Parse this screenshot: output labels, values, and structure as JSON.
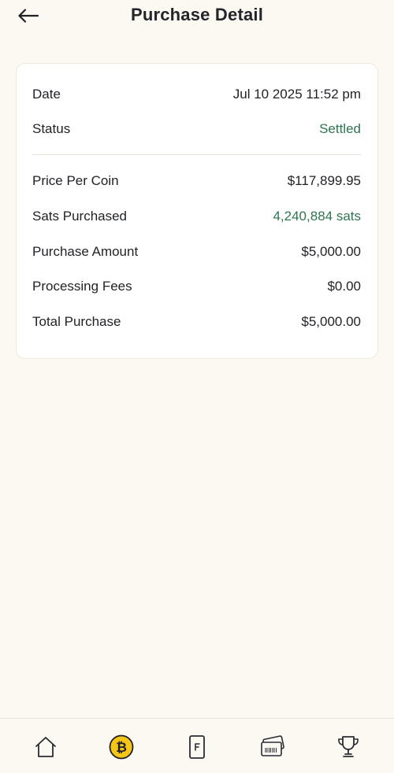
{
  "header": {
    "title": "Purchase Detail",
    "back_icon": "arrow-left-icon"
  },
  "details": {
    "date_label": "Date",
    "date_value": "Jul 10 2025 11:52 pm",
    "status_label": "Status",
    "status_value": "Settled",
    "price_label": "Price Per Coin",
    "price_value": "$117,899.95",
    "sats_label": "Sats Purchased",
    "sats_value": "4,240,884 sats",
    "amount_label": "Purchase Amount",
    "amount_value": "$5,000.00",
    "fees_label": "Processing Fees",
    "fees_value": "$0.00",
    "total_label": "Total Purchase",
    "total_value": "$5,000.00"
  },
  "nav": {
    "items": [
      {
        "icon": "home-icon",
        "active": false
      },
      {
        "icon": "bitcoin-icon",
        "active": true
      },
      {
        "icon": "fold-card-icon",
        "active": false
      },
      {
        "icon": "gift-cards-icon",
        "active": false
      },
      {
        "icon": "trophy-icon",
        "active": false
      }
    ]
  },
  "colors": {
    "background": "#fcf9f2",
    "card": "#ffffff",
    "accent_green": "#2e7550",
    "bitcoin_yellow": "#f5c518",
    "text": "#1f2126"
  }
}
